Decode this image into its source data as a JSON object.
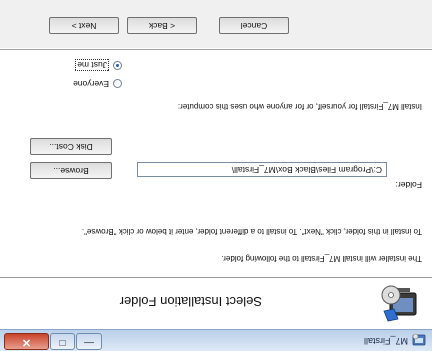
{
  "window": {
    "title": "M7_Firstall"
  },
  "banner": {
    "title": "Select Installation Folder"
  },
  "body": {
    "intro": "The installer will install M7_Firstall to the following folder.",
    "instruction": "To install in this folder, click \"Next\". To install to a different folder, enter it below or click \"Browse\".",
    "folder_label": "Folder:",
    "folder_value": "C:\\Program Files\\Black Box\\M7_Firstall\\",
    "browse_label": "Browse...",
    "disk_cost_label": "Disk Cost...",
    "install_for_text": "Install M7_Firstall for yourself, or for anyone who uses this computer:",
    "radio_everyone": "Everyone",
    "radio_just_me": "Just me",
    "selected_option": "Just me"
  },
  "footer": {
    "cancel_label": "Cancel",
    "back_label": "< Back",
    "next_label": "Next >"
  },
  "icons": {
    "app": "installer-app-icon",
    "banner": "computer-cd-installer-icon"
  }
}
